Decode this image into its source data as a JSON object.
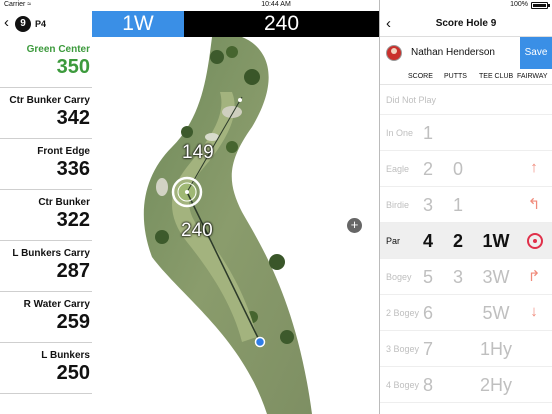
{
  "status_bar": {
    "carrier": "Carrier ≈",
    "time": "10:44 AM",
    "battery": "100%"
  },
  "header": {
    "hole_number": "9",
    "par": "P4",
    "club": "1W",
    "distance": "240"
  },
  "distances": [
    {
      "label": "Green Center",
      "value": "350",
      "highlight": true
    },
    {
      "label": "Ctr Bunker Carry",
      "value": "342"
    },
    {
      "label": "Front Edge",
      "value": "336"
    },
    {
      "label": "Ctr Bunker",
      "value": "322"
    },
    {
      "label": "L Bunkers Carry",
      "value": "287"
    },
    {
      "label": "R Water Carry",
      "value": "259"
    },
    {
      "label": "L Bunkers",
      "value": "250"
    }
  ],
  "map": {
    "label_upper": "149",
    "label_lower": "240",
    "plus": "+"
  },
  "score_panel": {
    "title": "Score Hole 9",
    "player_name": "Nathan Henderson",
    "save_label": "Save",
    "columns": [
      "SCORE",
      "PUTTS",
      "TEE CLUB",
      "FAIRWAY"
    ],
    "rows": [
      {
        "name": "Did Not Play",
        "score": "",
        "putts": "",
        "club": "",
        "fairway": ""
      },
      {
        "name": "In One",
        "score": "1",
        "putts": "",
        "club": "",
        "fairway": ""
      },
      {
        "name": "Eagle",
        "score": "2",
        "putts": "0",
        "club": "",
        "fairway": "↑"
      },
      {
        "name": "Birdie",
        "score": "3",
        "putts": "1",
        "club": "",
        "fairway": "↰"
      },
      {
        "name": "Par",
        "score": "4",
        "putts": "2",
        "club": "1W",
        "fairway": ""
      },
      {
        "name": "Bogey",
        "score": "5",
        "putts": "3",
        "club": "3W",
        "fairway": "↱"
      },
      {
        "name": "2 Bogey",
        "score": "6",
        "putts": "",
        "club": "5W",
        "fairway": "↓"
      },
      {
        "name": "3 Bogey",
        "score": "7",
        "putts": "",
        "club": "1Hy",
        "fairway": ""
      },
      {
        "name": "4 Bogey",
        "score": "8",
        "putts": "",
        "club": "2Hy",
        "fairway": ""
      }
    ]
  },
  "colors": {
    "accent": "#3a8fe6",
    "green_text": "#3c9a3c",
    "target": "#e0304a"
  }
}
